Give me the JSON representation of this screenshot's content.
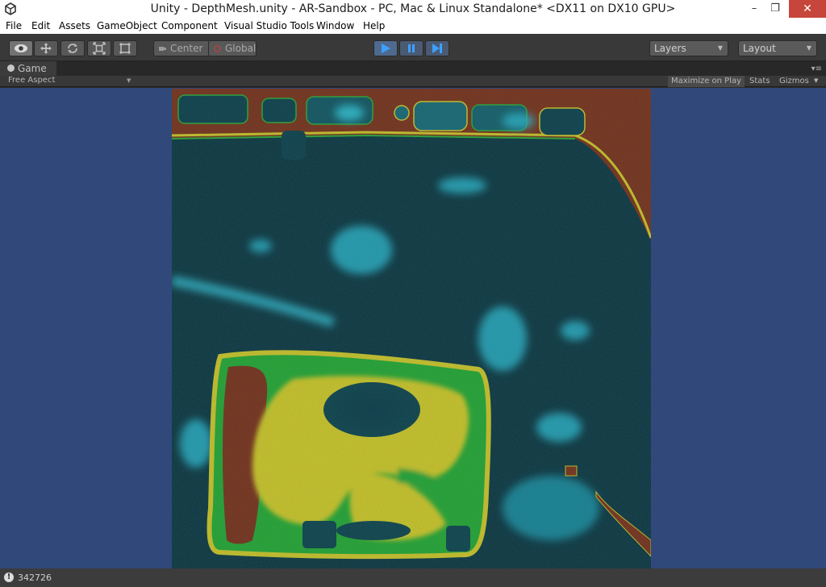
{
  "window": {
    "title": "Unity - DepthMesh.unity - AR-Sandbox - PC, Mac & Linux Standalone* <DX11 on DX10 GPU>",
    "minimize_label": "–",
    "maximize_label": "❐",
    "close_label": "✕"
  },
  "menu": [
    "File",
    "Edit",
    "Assets",
    "GameObject",
    "Component",
    "Visual Studio Tools",
    "Window",
    "Help"
  ],
  "toolbar": {
    "tools": [
      "view-tool",
      "move-tool",
      "rotate-tool",
      "scale-tool",
      "rect-tool"
    ],
    "pivot_label": "Center",
    "space_label": "Global",
    "layers_label": "Layers",
    "layout_label": "Layout",
    "playing": true
  },
  "game_panel": {
    "tab_label": "Game",
    "aspect_label": "Free Aspect",
    "maximize_label": "Maximize on Play",
    "stats_label": "Stats",
    "gizmos_label": "Gizmos"
  },
  "status": {
    "message": "342726"
  },
  "colors": {
    "water": "#0f3440",
    "water_highlight": "#2fb5c8",
    "land_low": "#7e2a10",
    "grass": "#27a32a",
    "sand": "#d6c41e",
    "play_active": "#4f6a8f",
    "game_bg": "#30497a"
  }
}
